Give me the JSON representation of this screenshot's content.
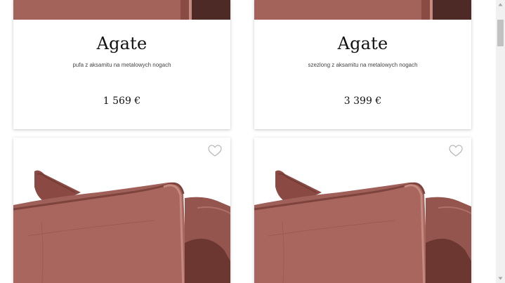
{
  "products": [
    {
      "name": "Agate",
      "description": "pufa z aksamitu na metalowych nogach",
      "price": "1 569 €"
    },
    {
      "name": "Agate",
      "description": "szezlong z aksamitu na metalowych nogach",
      "price": "3 399 €"
    }
  ],
  "icons": {
    "favorite": "heart-icon"
  },
  "colors": {
    "velvet": "#9a5a52",
    "velvet_dark": "#6a3530",
    "velvet_light": "#b87a70",
    "card_bg": "#ffffff",
    "text": "#111111"
  }
}
